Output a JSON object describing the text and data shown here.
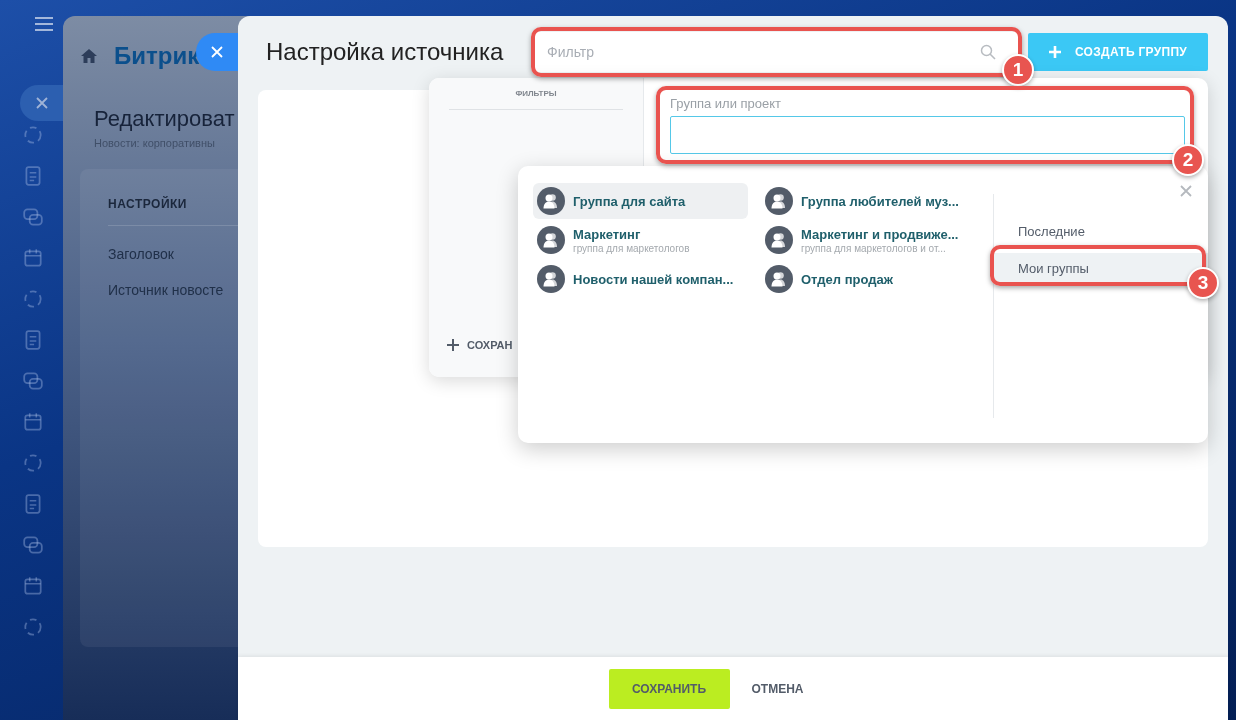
{
  "back_slider": {
    "logo": "Битрик",
    "title": "Редактироват",
    "subtitle": "Новости: корпоративны",
    "menu_heading": "НАСТРОЙКИ",
    "menu_items": [
      "Заголовок",
      "Источник новосте"
    ]
  },
  "dialog": {
    "title": "Настройка источника",
    "filter": {
      "placeholder": "Фильтр"
    },
    "create_button": "СОЗДАТЬ ГРУППУ",
    "filter_popup": {
      "heading": "ФИЛЬТРЫ",
      "save_link": "СОХРАН",
      "field_label": "Группа или проект"
    },
    "dropdown": {
      "items": [
        {
          "name": "Группа для сайта",
          "selected": true
        },
        {
          "name": "Маркетинг",
          "description": "группа для маркетологов",
          "selected": false
        },
        {
          "name": "Новости нашей компан...",
          "selected": false
        },
        {
          "name": "Группа любителей муз...",
          "selected": false
        },
        {
          "name": "Маркетинг и продвиже...",
          "description": "группа для маркетологов и от...",
          "selected": false
        },
        {
          "name": "Отдел продаж",
          "selected": false
        }
      ],
      "tabs": [
        {
          "label": "Последние",
          "selected": false
        },
        {
          "label": "Мои группы",
          "selected": true
        }
      ]
    },
    "footer": {
      "save_button": "СОХРАНИТЬ",
      "cancel_button": "ОТМЕНА"
    }
  },
  "annotations": [
    {
      "number": "1"
    },
    {
      "number": "2"
    },
    {
      "number": "3"
    }
  ]
}
